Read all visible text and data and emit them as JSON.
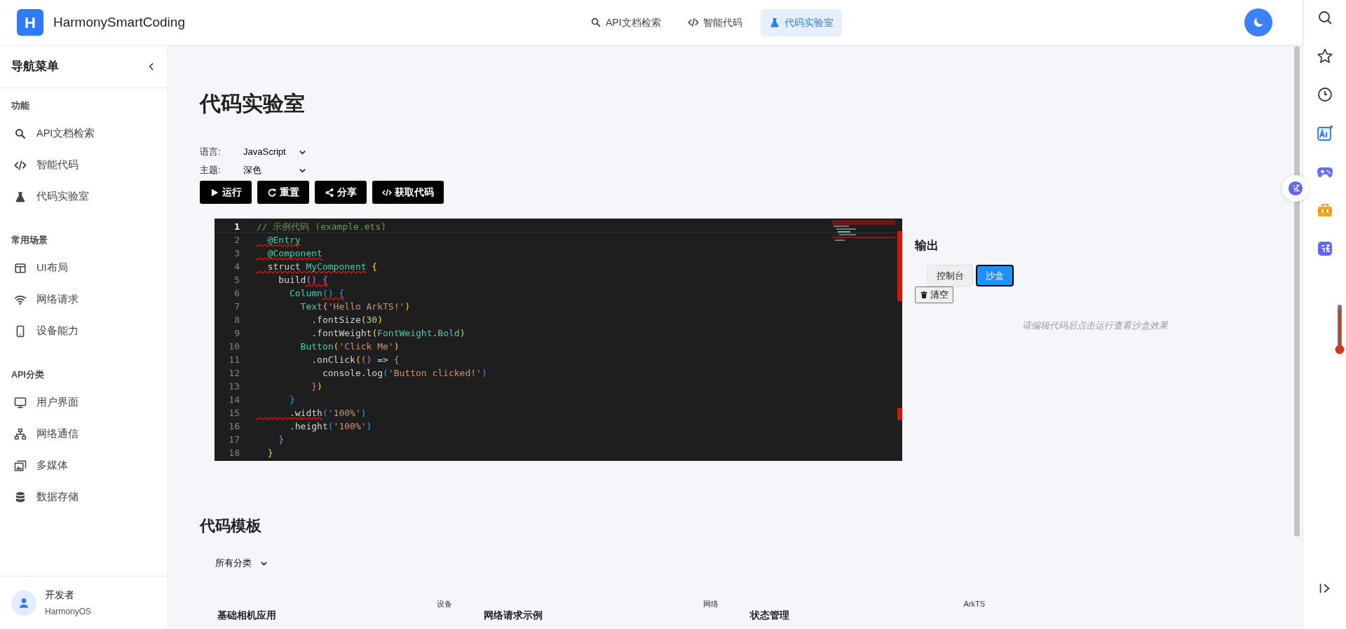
{
  "header": {
    "logo_letter": "H",
    "app_name": "HarmonySmartCoding",
    "nav": [
      {
        "label": "API文档检索",
        "selected": false
      },
      {
        "label": "智能代码",
        "selected": false
      },
      {
        "label": "代码实验室",
        "selected": true
      }
    ]
  },
  "sidebar": {
    "title": "导航菜单",
    "sections": [
      {
        "title": "功能",
        "items": [
          {
            "label": "API文档检索"
          },
          {
            "label": "智能代码"
          },
          {
            "label": "代码实验室"
          }
        ]
      },
      {
        "title": "常用场景",
        "items": [
          {
            "label": "UI布局"
          },
          {
            "label": "网络请求"
          },
          {
            "label": "设备能力"
          }
        ]
      },
      {
        "title": "API分类",
        "items": [
          {
            "label": "用户界面"
          },
          {
            "label": "网络通信"
          },
          {
            "label": "多媒体"
          },
          {
            "label": "数据存储"
          }
        ]
      }
    ],
    "user": {
      "name": "开发者",
      "subtitle": "HarmonyOS"
    }
  },
  "page": {
    "title": "代码实验室",
    "settings": [
      {
        "label": "语言:",
        "value": "JavaScript"
      },
      {
        "label": "主题:",
        "value": "深色"
      }
    ],
    "buttons": [
      {
        "label": "运行"
      },
      {
        "label": "重置"
      },
      {
        "label": "分享"
      },
      {
        "label": "获取代码"
      }
    ],
    "editor": {
      "lines": [
        {
          "number": "1",
          "current": true,
          "tokens": [
            {
              "t": "// 示例代码 (example.ets)",
              "kind": "comment",
              "error": false
            }
          ]
        },
        {
          "number": "2",
          "current": false,
          "tokens": [
            {
              "t": "  @Entry",
              "kind": "type",
              "error": true
            }
          ]
        },
        {
          "number": "3",
          "current": false,
          "tokens": [
            {
              "t": "  @Component",
              "kind": "type",
              "error": true
            }
          ]
        },
        {
          "number": "4",
          "current": false,
          "tokens": [
            {
              "t": "  struct ",
              "kind": "plain",
              "error": true
            },
            {
              "t": "MyComponent",
              "kind": "type",
              "error": true
            },
            {
              "t": " {",
              "kind": "brace1",
              "error": false
            }
          ]
        },
        {
          "number": "5",
          "current": false,
          "tokens": [
            {
              "t": "    build",
              "kind": "plain",
              "error": false
            },
            {
              "t": "() {",
              "kind": "brace2",
              "error": true
            }
          ]
        },
        {
          "number": "6",
          "current": false,
          "tokens": [
            {
              "t": "      Column",
              "kind": "type",
              "error": false
            },
            {
              "t": "() {",
              "kind": "brace3",
              "error": true
            }
          ]
        },
        {
          "number": "7",
          "current": false,
          "tokens": [
            {
              "t": "        Text",
              "kind": "type",
              "error": false
            },
            {
              "t": "(",
              "kind": "brace1",
              "error": false
            },
            {
              "t": "'Hello ArkTS!'",
              "kind": "string",
              "error": false
            },
            {
              "t": ")",
              "kind": "brace1",
              "error": false
            }
          ]
        },
        {
          "number": "8",
          "current": false,
          "tokens": [
            {
              "t": "          .fontSize",
              "kind": "plain",
              "error": false
            },
            {
              "t": "(",
              "kind": "brace1",
              "error": false
            },
            {
              "t": "30",
              "kind": "number",
              "error": false
            },
            {
              "t": ")",
              "kind": "brace1",
              "error": false
            }
          ]
        },
        {
          "number": "9",
          "current": false,
          "tokens": [
            {
              "t": "          .fontWeight",
              "kind": "plain",
              "error": false
            },
            {
              "t": "(",
              "kind": "brace1",
              "error": false
            },
            {
              "t": "FontWeight",
              "kind": "type",
              "error": false
            },
            {
              "t": ".",
              "kind": "plain",
              "error": false
            },
            {
              "t": "Bold",
              "kind": "type",
              "error": false
            },
            {
              "t": ")",
              "kind": "brace1",
              "error": false
            }
          ]
        },
        {
          "number": "10",
          "current": false,
          "tokens": [
            {
              "t": "        Button",
              "kind": "type",
              "error": false
            },
            {
              "t": "(",
              "kind": "brace1",
              "error": false
            },
            {
              "t": "'Click Me'",
              "kind": "string",
              "error": false
            },
            {
              "t": ")",
              "kind": "brace1",
              "error": false
            }
          ]
        },
        {
          "number": "11",
          "current": false,
          "tokens": [
            {
              "t": "          .onClick",
              "kind": "plain",
              "error": false
            },
            {
              "t": "(",
              "kind": "brace1",
              "error": false
            },
            {
              "t": "()",
              "kind": "brace2",
              "error": false
            },
            {
              "t": " => ",
              "kind": "plain",
              "error": false
            },
            {
              "t": "{",
              "kind": "brace2",
              "error": false
            }
          ]
        },
        {
          "number": "12",
          "current": false,
          "tokens": [
            {
              "t": "            console.log",
              "kind": "plain",
              "error": false
            },
            {
              "t": "(",
              "kind": "brace3",
              "error": false
            },
            {
              "t": "'Button clicked!'",
              "kind": "string",
              "error": false
            },
            {
              "t": ")",
              "kind": "brace3",
              "error": false
            }
          ]
        },
        {
          "number": "13",
          "current": false,
          "tokens": [
            {
              "t": "          }",
              "kind": "brace2",
              "error": false
            },
            {
              "t": ")",
              "kind": "brace1",
              "error": false
            }
          ]
        },
        {
          "number": "14",
          "current": false,
          "tokens": [
            {
              "t": "      }",
              "kind": "brace3",
              "error": false
            }
          ]
        },
        {
          "number": "15",
          "current": false,
          "tokens": [
            {
              "t": "      .width",
              "kind": "plain",
              "error": true
            },
            {
              "t": "(",
              "kind": "brace3",
              "error": false
            },
            {
              "t": "'100%'",
              "kind": "string",
              "error": false
            },
            {
              "t": ")",
              "kind": "brace3",
              "error": false
            }
          ]
        },
        {
          "number": "16",
          "current": false,
          "tokens": [
            {
              "t": "      .height",
              "kind": "plain",
              "error": false
            },
            {
              "t": "(",
              "kind": "brace3",
              "error": false
            },
            {
              "t": "'100%'",
              "kind": "string",
              "error": false
            },
            {
              "t": ")",
              "kind": "brace3",
              "error": false
            }
          ]
        },
        {
          "number": "17",
          "current": false,
          "tokens": [
            {
              "t": "    }",
              "kind": "brace2",
              "error": false
            }
          ]
        },
        {
          "number": "18",
          "current": false,
          "tokens": [
            {
              "t": "  }",
              "kind": "brace1",
              "error": false
            }
          ]
        }
      ]
    },
    "output": {
      "title": "输出",
      "tabs": [
        {
          "label": "控制台",
          "selected": false
        },
        {
          "label": "沙盒",
          "selected": true
        }
      ],
      "clear_label": "清空",
      "message": "请编辑代码后点击运行查看沙盒效果"
    },
    "templates": {
      "title": "代码模板",
      "filter": "所有分类",
      "cards": [
        {
          "category": "设备",
          "title": "基础相机应用"
        },
        {
          "category": "网络",
          "title": "网络请求示例"
        },
        {
          "category": "ArkTS",
          "title": "状态管理"
        }
      ]
    }
  }
}
